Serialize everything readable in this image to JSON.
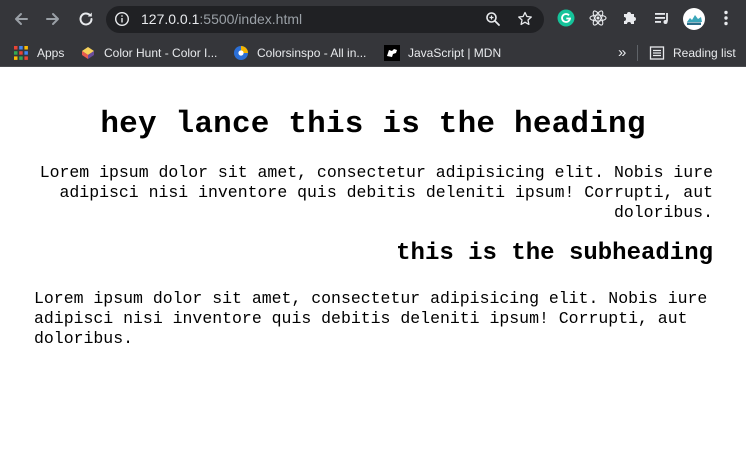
{
  "browser": {
    "url_host": "127.0.0.1",
    "url_rest": ":5500/index.html",
    "icons": {
      "back": "arrow-left-icon",
      "forward": "arrow-right-icon",
      "reload": "reload-icon",
      "info": "info-icon",
      "zoom": "zoom-icon",
      "bookmark": "star-icon"
    },
    "extensions": [
      "grammarly-icon",
      "react-devtools-icon",
      "puzzle-extensions-icon",
      "media-queue-icon",
      "profile-avatar",
      "more-menu-icon"
    ]
  },
  "bookmarks": {
    "apps_label": "Apps",
    "items": [
      {
        "label": "Color Hunt - Color I...",
        "icon": "colorhunt-icon"
      },
      {
        "label": "Colorsinspo - All in...",
        "icon": "colorsinspo-icon"
      },
      {
        "label": "JavaScript | MDN",
        "icon": "mdn-icon"
      }
    ],
    "overflow": "»",
    "reading_list": "Reading list"
  },
  "page": {
    "heading": "hey lance this is the heading",
    "paragraph1": "Lorem ipsum dolor sit amet, consectetur adipisicing elit. Nobis iure adipisci nisi inventore quis debitis deleniti ipsum! Corrupti, aut doloribus.",
    "subheading": "this is the subheading",
    "paragraph2": "Lorem ipsum dolor sit amet, consectetur adipisicing elit. Nobis iure adipisci nisi inventore quis debitis deleniti ipsum! Corrupti, aut doloribus."
  },
  "colors": {
    "chrome_bg": "#35363a",
    "omnibox_bg": "#202124",
    "grammarly": "#15c39a",
    "react": "#61dafb"
  }
}
